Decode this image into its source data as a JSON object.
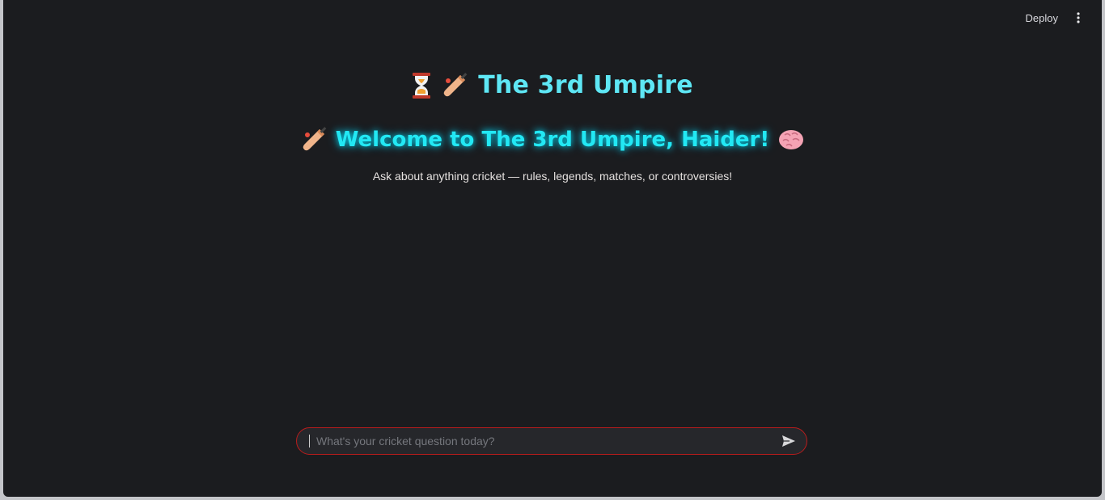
{
  "toolbar": {
    "deploy_label": "Deploy",
    "menu_icon": "more-vertical-icon"
  },
  "header": {
    "title": "The 3rd Umpire",
    "title_icons": [
      "hourglass-icon",
      "cricket-bat-icon"
    ],
    "welcome": "Welcome to The 3rd Umpire, Haider!",
    "welcome_icons": [
      "cricket-bat-icon",
      "brain-icon"
    ],
    "subtitle": "Ask about anything cricket — rules, legends, matches, or controversies!"
  },
  "chat": {
    "placeholder": "What's your cricket question today?",
    "value": "",
    "send_icon": "send-icon"
  },
  "colors": {
    "background": "#1b1c1f",
    "title": "#5ee7f5",
    "welcome": "#22e8f4",
    "input_border": "#b91c1c"
  }
}
